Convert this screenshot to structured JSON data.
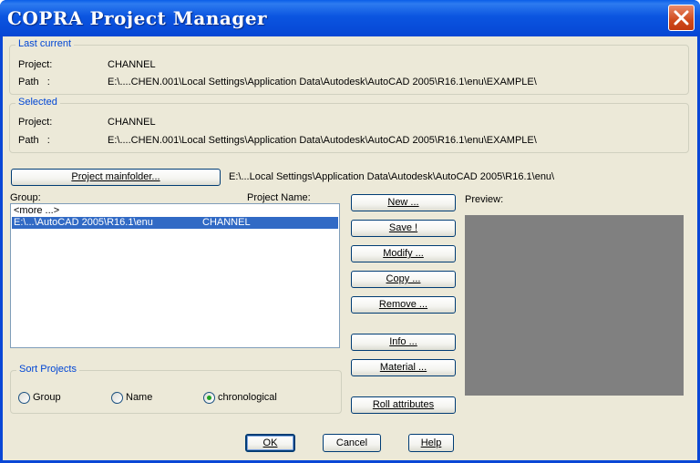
{
  "window": {
    "title": "COPRA Project Manager"
  },
  "last_current": {
    "title": "Last current",
    "project_label": "Project:",
    "project_value": "CHANNEL",
    "path_label": "Path   :",
    "path_value": "E:\\....CHEN.001\\Local Settings\\Application Data\\Autodesk\\AutoCAD 2005\\R16.1\\enu\\EXAMPLE\\"
  },
  "selected": {
    "title": "Selected",
    "project_label": "Project:",
    "project_value": "CHANNEL",
    "path_label": "Path   :",
    "path_value": "E:\\....CHEN.001\\Local Settings\\Application Data\\Autodesk\\AutoCAD 2005\\R16.1\\enu\\EXAMPLE\\"
  },
  "mainfolder": {
    "button_label": "Project mainfolder...",
    "path": "E:\\...Local Settings\\Application Data\\Autodesk\\AutoCAD 2005\\R16.1\\enu\\"
  },
  "list": {
    "group_header": "Group:",
    "name_header": "Project Name:",
    "rows": [
      {
        "group": "<more ...>",
        "name": ""
      },
      {
        "group": "E:\\...\\AutoCAD 2005\\R16.1\\enu",
        "name": "CHANNEL"
      }
    ]
  },
  "actions": {
    "new": "New ...",
    "save": "Save !",
    "modify": "Modify ...",
    "copy": "Copy ...",
    "remove": "Remove ...",
    "info": "Info ...",
    "material": "Material ...",
    "roll": "Roll attributes"
  },
  "preview": {
    "label": "Preview:"
  },
  "sort": {
    "title": "Sort Projects",
    "options": [
      "Group",
      "Name",
      "chronological"
    ],
    "selected": "chronological"
  },
  "footer": {
    "ok": "OK",
    "cancel": "Cancel",
    "help": "Help"
  },
  "colors": {
    "titlebar": "#0a47d6",
    "selection": "#316ac5",
    "group_title": "#0046d5",
    "preview_bg": "#808080"
  }
}
